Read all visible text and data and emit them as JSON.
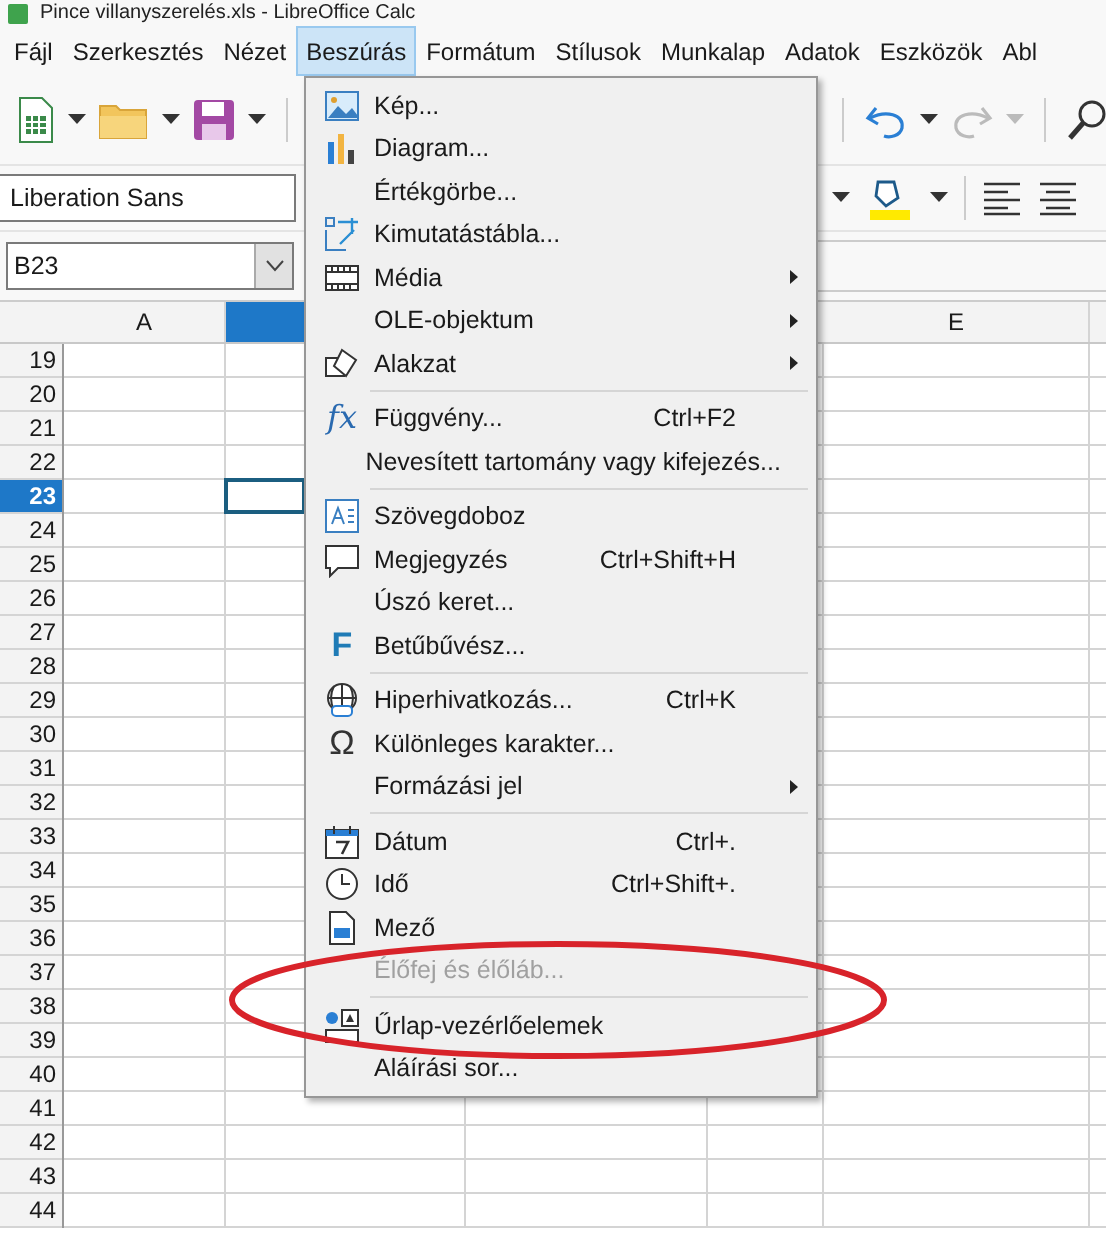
{
  "window": {
    "title": "Pince villanyszerelés.xls - LibreOffice Calc"
  },
  "menubar": [
    {
      "label": "Fájl",
      "selected": false
    },
    {
      "label": "Szerkesztés",
      "selected": false
    },
    {
      "label": "Nézet",
      "selected": false
    },
    {
      "label": "Beszúrás",
      "selected": true
    },
    {
      "label": "Formátum",
      "selected": false
    },
    {
      "label": "Stílusok",
      "selected": false
    },
    {
      "label": "Munkalap",
      "selected": false
    },
    {
      "label": "Adatok",
      "selected": false
    },
    {
      "label": "Eszközök",
      "selected": false
    },
    {
      "label": "Abl",
      "selected": false
    }
  ],
  "formatting_bar": {
    "font_name": "Liberation Sans"
  },
  "formula_bar": {
    "name_box": "B23"
  },
  "columns": [
    {
      "label": "A",
      "selected": false
    },
    {
      "selected": true
    },
    {
      "label": "E",
      "selected": false
    }
  ],
  "rows": [
    {
      "label": "19",
      "selected": false
    },
    {
      "label": "20",
      "selected": false
    },
    {
      "label": "21",
      "selected": false
    },
    {
      "label": "22",
      "selected": false
    },
    {
      "label": "23",
      "selected": true
    },
    {
      "label": "24",
      "selected": false
    },
    {
      "label": "25",
      "selected": false
    },
    {
      "label": "26",
      "selected": false
    },
    {
      "label": "27",
      "selected": false
    },
    {
      "label": "28",
      "selected": false
    },
    {
      "label": "29",
      "selected": false
    },
    {
      "label": "30",
      "selected": false
    },
    {
      "label": "31",
      "selected": false
    },
    {
      "label": "32",
      "selected": false
    },
    {
      "label": "33",
      "selected": false
    },
    {
      "label": "34",
      "selected": false
    },
    {
      "label": "35",
      "selected": false
    },
    {
      "label": "36",
      "selected": false
    },
    {
      "label": "37",
      "selected": false
    },
    {
      "label": "38",
      "selected": false
    },
    {
      "label": "39",
      "selected": false
    },
    {
      "label": "40",
      "selected": false
    },
    {
      "label": "41",
      "selected": false
    },
    {
      "label": "42",
      "selected": false
    },
    {
      "label": "43",
      "selected": false
    },
    {
      "label": "44",
      "selected": false
    }
  ],
  "insert_menu": {
    "items": [
      {
        "kind": "item",
        "label": "Kép...",
        "submenu": false,
        "disabled": false
      },
      {
        "kind": "item",
        "label": "Diagram...",
        "submenu": false,
        "disabled": false
      },
      {
        "kind": "item",
        "label": "Értékgörbe...",
        "submenu": false,
        "disabled": false
      },
      {
        "kind": "item",
        "label": "Kimutatástábla...",
        "submenu": false,
        "disabled": false
      },
      {
        "kind": "item",
        "label": "Média",
        "submenu": true,
        "disabled": false
      },
      {
        "kind": "item",
        "label": "OLE-objektum",
        "submenu": true,
        "disabled": false
      },
      {
        "kind": "item",
        "label": "Alakzat",
        "submenu": true,
        "disabled": false
      },
      {
        "kind": "separator"
      },
      {
        "kind": "item",
        "label": "Függvény...",
        "shortcut": "Ctrl+F2",
        "glyph": "fx",
        "submenu": false,
        "disabled": false
      },
      {
        "kind": "item",
        "label": "Nevesített tartomány vagy kifejezés...",
        "submenu": false,
        "disabled": false
      },
      {
        "kind": "separator"
      },
      {
        "kind": "item",
        "label": "Szövegdoboz",
        "submenu": false,
        "disabled": false
      },
      {
        "kind": "item",
        "label": "Megjegyzés",
        "shortcut": "Ctrl+Shift+H",
        "submenu": false,
        "disabled": false
      },
      {
        "kind": "item",
        "label": "Úszó keret...",
        "submenu": false,
        "disabled": false
      },
      {
        "kind": "item",
        "label": "Betűbűvész...",
        "glyph": "F",
        "submenu": false,
        "disabled": false
      },
      {
        "kind": "separator"
      },
      {
        "kind": "item",
        "label": "Hiperhivatkozás...",
        "shortcut": "Ctrl+K",
        "submenu": false,
        "disabled": false
      },
      {
        "kind": "item",
        "label": "Különleges karakter...",
        "glyph": "Ω",
        "submenu": false,
        "disabled": false
      },
      {
        "kind": "item",
        "label": "Formázási jel",
        "submenu": true,
        "disabled": false
      },
      {
        "kind": "separator"
      },
      {
        "kind": "item",
        "label": "Dátum",
        "shortcut": "Ctrl+.",
        "submenu": false,
        "disabled": false
      },
      {
        "kind": "item",
        "label": "Idő",
        "shortcut": "Ctrl+Shift+.",
        "submenu": false,
        "disabled": false
      },
      {
        "kind": "item",
        "label": "Mező",
        "submenu": false,
        "disabled": false
      },
      {
        "kind": "item",
        "label": "Élőfej és élőláb...",
        "submenu": false,
        "disabled": true
      },
      {
        "kind": "separator"
      },
      {
        "kind": "item",
        "label": "Űrlap-vezérlőelemek",
        "submenu": false,
        "disabled": false
      },
      {
        "kind": "item",
        "label": "Aláírási sor...",
        "submenu": false,
        "disabled": false
      }
    ]
  }
}
